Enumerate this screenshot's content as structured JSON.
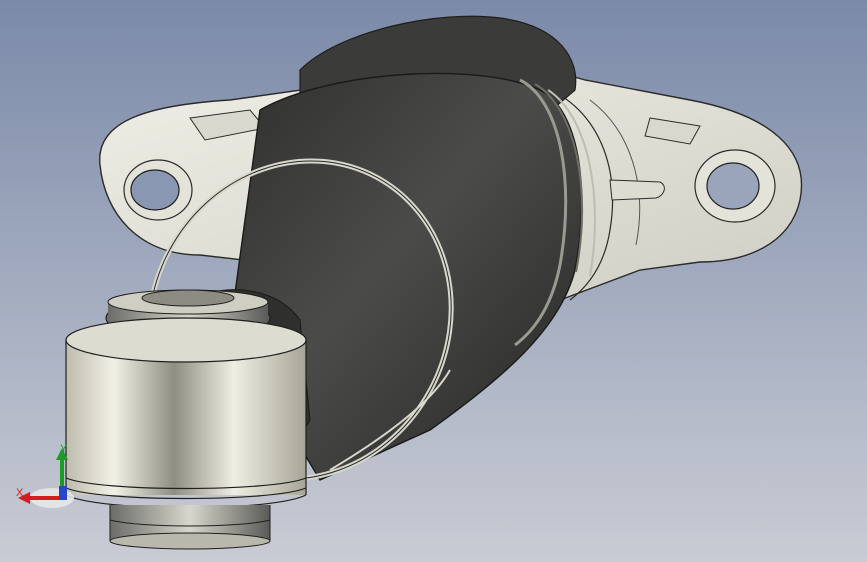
{
  "viewport": {
    "background_top": "#7b8aa9",
    "background_bottom": "#c9ccd4",
    "model_colors": {
      "flange": "#e6e5dc",
      "cylinder_dark": "#3e3e3d",
      "bushing": "#d9d8cd"
    }
  },
  "triad": {
    "x_label": "X",
    "y_label": "Y",
    "x_color": "#d21e1e",
    "y_color": "#1e9a2a",
    "z_color": "#2b45c8"
  }
}
